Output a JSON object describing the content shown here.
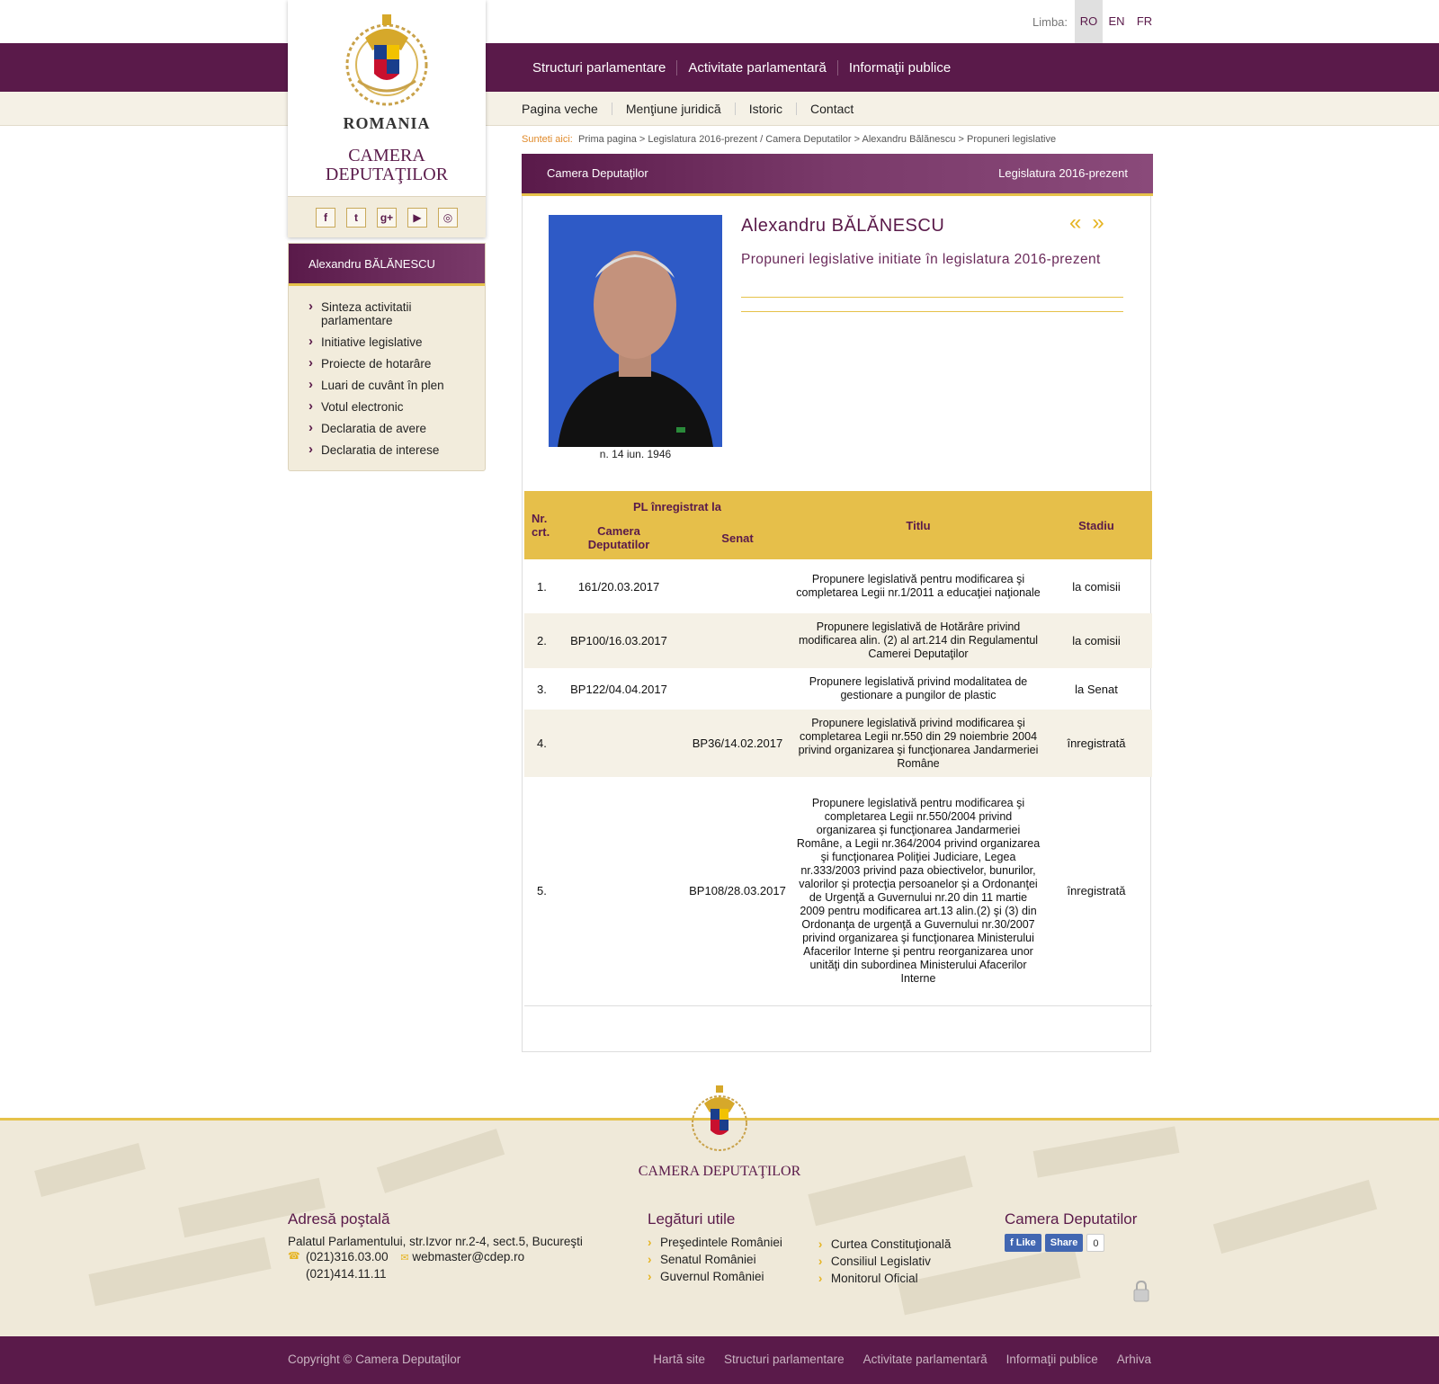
{
  "language": {
    "label": "Limba:",
    "options": [
      "RO",
      "EN",
      "FR"
    ],
    "active": "RO"
  },
  "logo": {
    "country": "ROMANIA",
    "line1": "CAMERA",
    "line2": "DEPUTAŢILOR",
    "seal_text": "CAMERA DEPUTATILOR"
  },
  "social": [
    "facebook-icon",
    "twitter-icon",
    "google-plus-icon",
    "youtube-icon",
    "instagram-icon"
  ],
  "nav_main": [
    "Structuri parlamentare",
    "Activitate parlamentară",
    "Informaţii publice"
  ],
  "nav_secondary": [
    "Pagina veche",
    "Menţiune juridică",
    "Istoric",
    "Contact"
  ],
  "breadcrumb": {
    "label": "Sunteti aici:",
    "path": "Prima pagina > Legislatura 2016-prezent / Camera Deputatilor > Alexandru Bălănescu > Propuneri legislative"
  },
  "sidebar": {
    "title": "Alexandru BĂLĂNESCU",
    "items": [
      "Sinteza activitatii parlamentare",
      "Initiative legislative",
      "Proiecte de hotarâre",
      "Luari de cuvânt în plen",
      "Votul electronic",
      "Declaratia de avere",
      "Declaratia de interese"
    ]
  },
  "panel": {
    "left": "Camera Deputaţilor",
    "right": "Legislatura 2016-prezent"
  },
  "profile": {
    "name": "Alexandru BĂLĂNESCU",
    "born": "n. 14 iun. 1946",
    "subtitle": "Propuneri legislative initiate în legislatura 2016-prezent",
    "prev": "«",
    "next": "»"
  },
  "table": {
    "headers": {
      "nr": "Nr. crt.",
      "pl": "PL înregistrat la",
      "cd": "Camera Deputatilor",
      "senat": "Senat",
      "titlu": "Titlu",
      "stadiu": "Stadiu"
    },
    "rows": [
      {
        "nr": "1.",
        "cd": "161/20.03.2017",
        "senat": "",
        "titlu": "Propunere legislativă pentru modificarea şi completarea Legii nr.1/2011 a educaţiei naţionale",
        "stadiu": "la comisii"
      },
      {
        "nr": "2.",
        "cd": "BP100/16.03.2017",
        "senat": "",
        "titlu": "Propunere legislativă de Hotărâre privind modificarea alin. (2) al art.214 din Regulamentul Camerei Deputaţilor",
        "stadiu": "la comisii"
      },
      {
        "nr": "3.",
        "cd": "BP122/04.04.2017",
        "senat": "",
        "titlu": "Propunere legislativă privind modalitatea de gestionare a pungilor de plastic",
        "stadiu": "la Senat"
      },
      {
        "nr": "4.",
        "cd": "",
        "senat": "BP36/14.02.2017",
        "titlu": "Propunere legislativă privind modificarea şi completarea Legii nr.550 din 29 noiembrie 2004 privind organizarea şi funcţionarea Jandarmeriei Române",
        "stadiu": "înregistrată"
      },
      {
        "nr": "5.",
        "cd": "",
        "senat": "BP108/28.03.2017",
        "titlu": "Propunere legislativă pentru modificarea şi completarea Legii nr.550/2004 privind organizarea şi funcţionarea Jandarmeriei Române, a Legii nr.364/2004 privind organizarea şi funcţionarea Poliţiei Judiciare, Legea nr.333/2003 privind paza obiectivelor, bunurilor, valorilor şi protecţia persoanelor şi a Ordonanţei de Urgenţă a Guvernului nr.20 din 11 martie 2009 pentru modificarea art.13 alin.(2) şi (3) din Ordonanţa de urgenţă a Guvernului nr.30/2007 privind organizarea şi funcţionarea Ministerului Afacerilor Interne şi pentru reorganizarea unor unităţi din subordinea Ministerului Afacerilor Interne",
        "stadiu": "înregistrată"
      }
    ]
  },
  "footer": {
    "title": "CAMERA DEPUTAŢILOR",
    "address": {
      "heading": "Adresă poştală",
      "line": "Palatul Parlamentului, str.Izvor nr.2-4, sect.5, Bucureşti",
      "phone1": "(021)316.03.00",
      "phone2": "(021)414.11.11",
      "email": "webmaster@cdep.ro"
    },
    "links": {
      "heading": "Legături utile",
      "col1": [
        "Preşedintele României",
        "Senatul României",
        "Guvernul României"
      ],
      "col2": [
        "Curtea Constituţională",
        "Consiliul Legislativ",
        "Monitorul Oficial"
      ]
    },
    "social": {
      "heading": "Camera Deputatilor",
      "like": "Like",
      "share": "Share",
      "count": "0"
    },
    "copyright": "Copyright © Camera Deputaţilor",
    "bottom_links": [
      "Hartă site",
      "Structuri parlamentare",
      "Activitate parlamentară",
      "Informaţii publice",
      "Arhiva"
    ]
  }
}
